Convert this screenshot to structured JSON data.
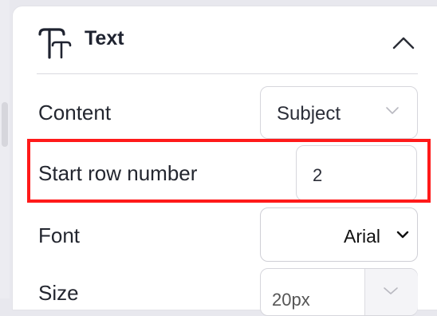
{
  "panel": {
    "section_title": "Text",
    "icon": "text-format-icon",
    "collapse_icon": "chevron-up-icon"
  },
  "rows": {
    "content": {
      "label": "Content",
      "value": "Subject",
      "icon": "chevron-down-icon"
    },
    "start_row": {
      "label": "Start row number",
      "value": "2"
    },
    "font": {
      "label": "Font",
      "value": "Arial",
      "icon": "chevron-down-icon"
    },
    "size": {
      "label": "Size",
      "value": "20px",
      "icon": "chevron-down-icon"
    }
  },
  "colors": {
    "highlight": "#ff1a1a",
    "text": "#23262f",
    "border": "#d6d6dc"
  }
}
